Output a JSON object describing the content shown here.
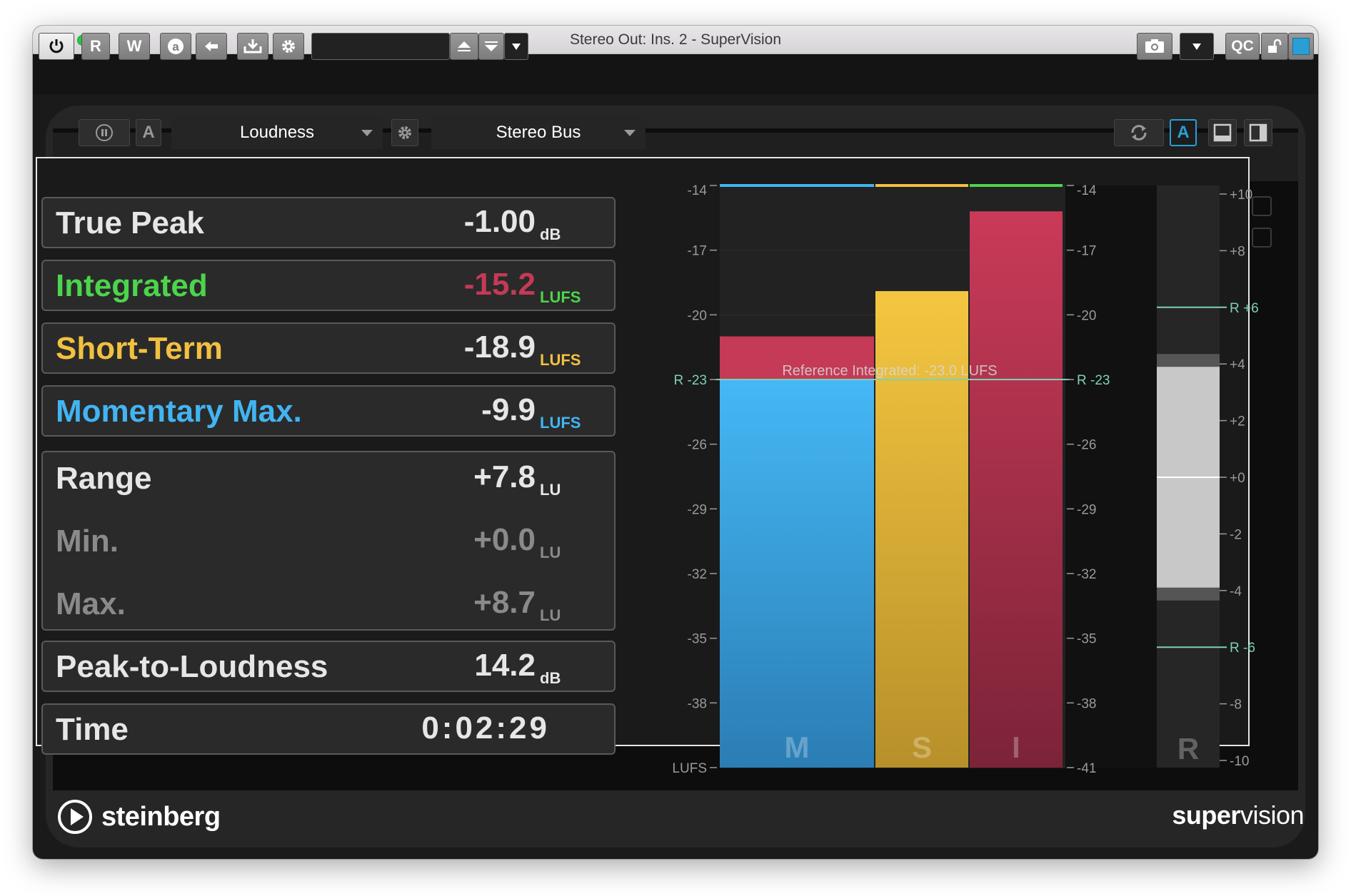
{
  "window": {
    "title": "Stereo Out: Ins. 2 - SuperVision"
  },
  "toolbar": {
    "read_label": "R",
    "write_label": "W",
    "qc_label": "QC",
    "preset_value": "",
    "accent": "#2a9fd6"
  },
  "plugin_bar": {
    "a_label": "A",
    "module": "Loudness",
    "channel": "Stereo Bus",
    "active_a_label": "A"
  },
  "readouts": [
    {
      "label": "True Peak",
      "value": "-1.00",
      "unit": "dB",
      "label_color": "#e6e6e6",
      "value_color": "#e6e6e6",
      "unit_color": "#e6e6e6"
    },
    {
      "label": "Integrated",
      "value": "-15.2",
      "unit": "LUFS",
      "label_color": "#4cd44c",
      "value_color": "#c43a57",
      "unit_color": "#4cd44c"
    },
    {
      "label": "Short-Term",
      "value": "-18.9",
      "unit": "LUFS",
      "label_color": "#f2c040",
      "value_color": "#e6e6e6",
      "unit_color": "#f2c040"
    },
    {
      "label": "Momentary Max.",
      "value": "-9.9",
      "unit": "LUFS",
      "label_color": "#42b4f2",
      "value_color": "#e6e6e6",
      "unit_color": "#42b4f2"
    }
  ],
  "range_group": {
    "range": {
      "label": "Range",
      "value": "+7.8",
      "unit": "LU"
    },
    "min": {
      "label": "Min.",
      "value": "+0.0",
      "unit": "LU"
    },
    "max": {
      "label": "Max.",
      "value": "+8.7",
      "unit": "LU"
    }
  },
  "plr": {
    "label": "Peak-to-Loudness",
    "value": "14.2",
    "unit": "dB"
  },
  "time": {
    "label": "Time",
    "value": "0:02:29"
  },
  "meter": {
    "scale_left": [
      "-14",
      "-17",
      "-20",
      "R -23",
      "-26",
      "-29",
      "-32",
      "-35",
      "-38",
      "LUFS"
    ],
    "scale_right": [
      "-14",
      "-17",
      "-20",
      "R -23",
      "-26",
      "-29",
      "-32",
      "-35",
      "-38",
      "-41"
    ],
    "reference_text": "Reference Integrated: -23.0 LUFS",
    "reference_lufs": -23.0,
    "range_lufs": [
      -41,
      -14
    ],
    "bars": [
      {
        "key": "M",
        "value_lufs": -23.0,
        "hold_lufs": -21.0,
        "color": "#42b4f2",
        "hold_color": "#c43a57"
      },
      {
        "key": "S",
        "value_lufs": -18.9,
        "color": "#f2c040"
      },
      {
        "key": "I",
        "value_lufs": -15.2,
        "color": "#c43a57"
      }
    ],
    "range_meter": {
      "key": "R",
      "scale": [
        "+10",
        "+8",
        "R +6",
        "+4",
        "+2",
        "+0",
        "-2",
        "-4",
        "R -6",
        "-8",
        "-10"
      ],
      "range_lu": [
        -10,
        10
      ],
      "fill_top_lu": 3.9,
      "fill_bottom_lu": -3.9
    }
  },
  "footer": {
    "logo": "steinberg",
    "brand_bold": "super",
    "brand_light": "vision"
  }
}
